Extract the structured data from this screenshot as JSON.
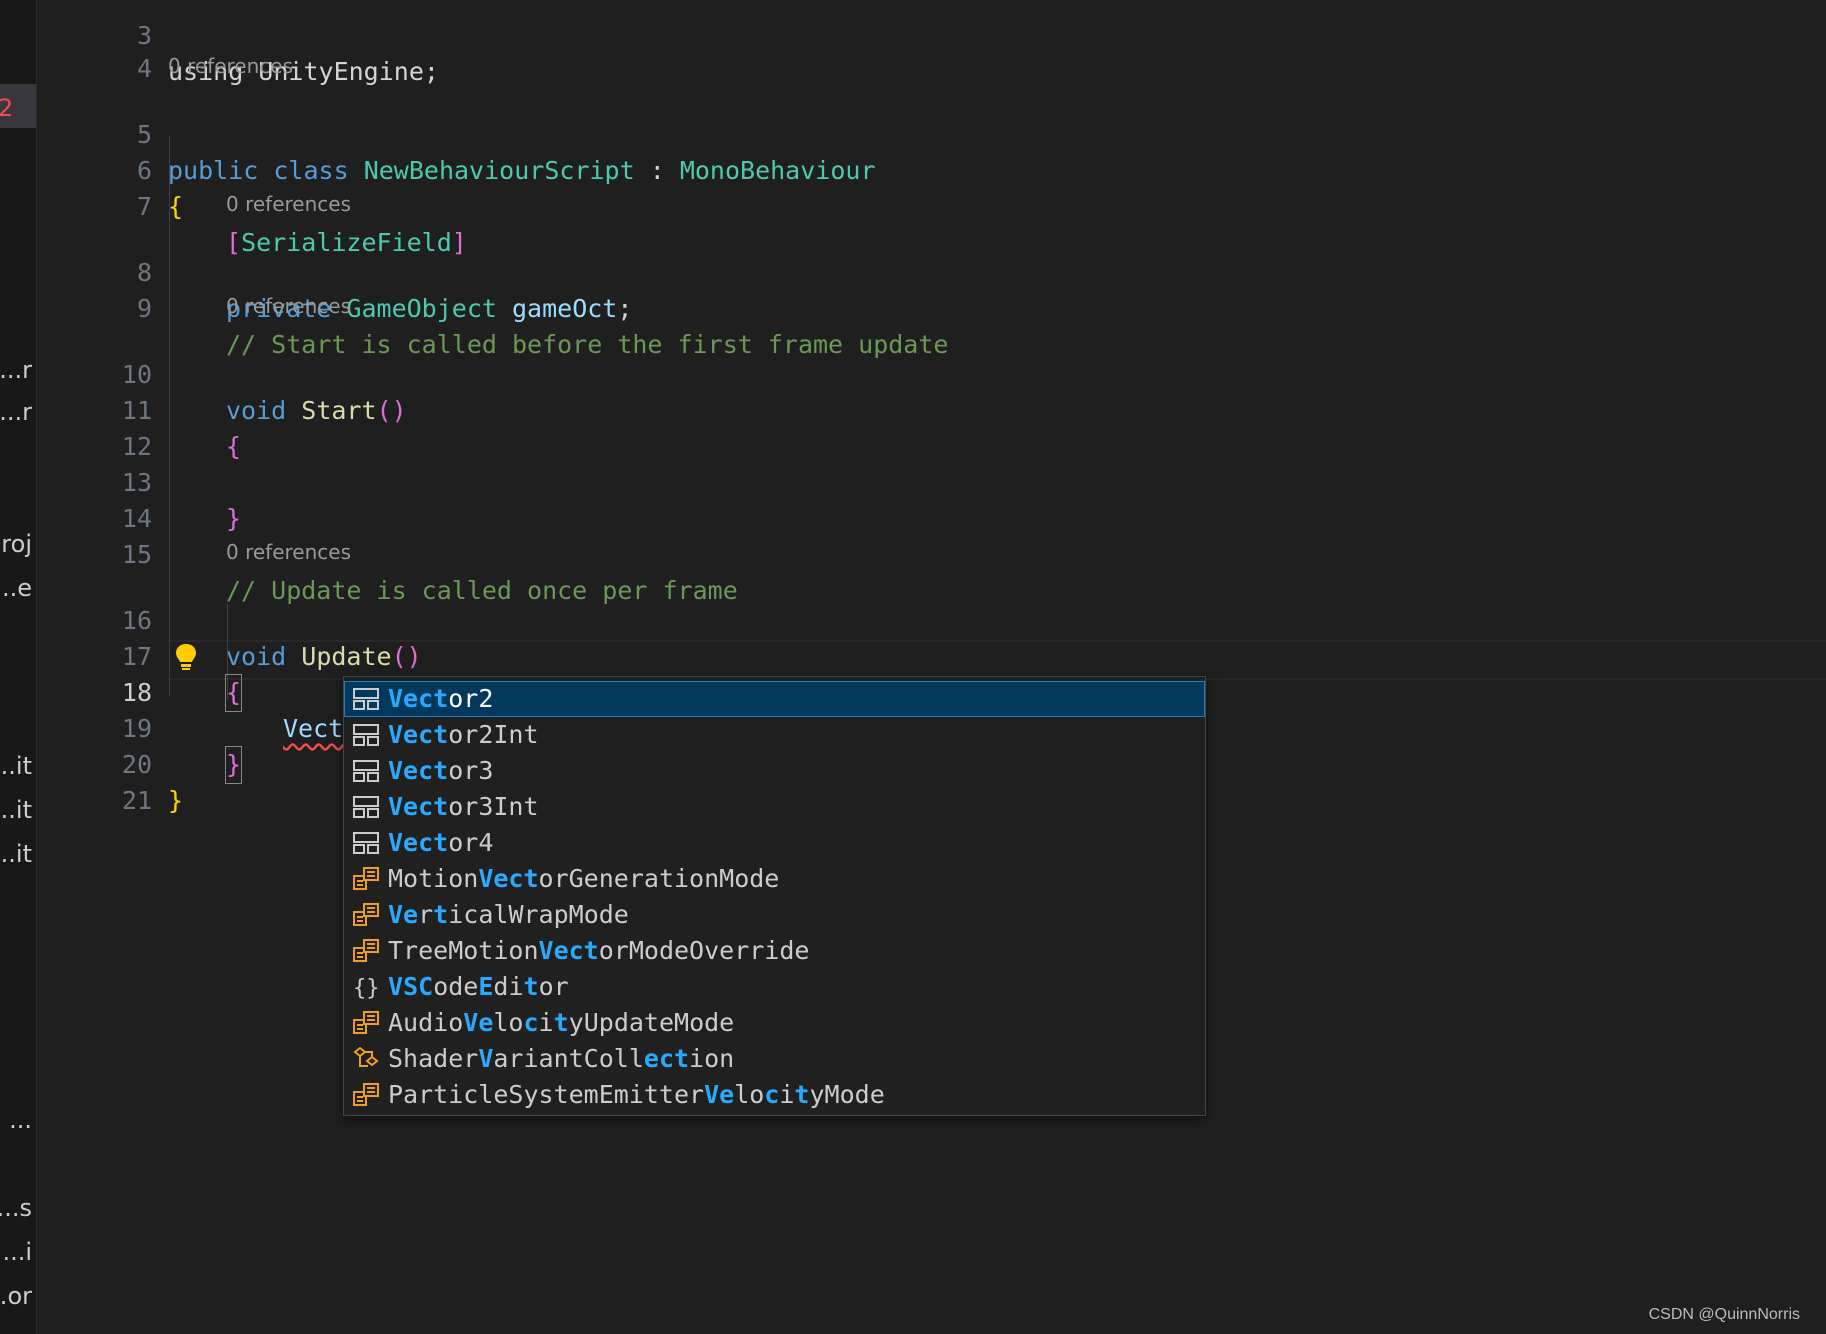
{
  "sidebar": {
    "active_marker": "2",
    "fragments": [
      "r...",
      "r...",
      "roj",
      "e...",
      "it...",
      "it...",
      "it...",
      "...",
      "s...",
      "i...",
      "or..."
    ]
  },
  "editor": {
    "lines": {
      "l3": {
        "num": "3",
        "code": "using UnityEngine;"
      },
      "l4": {
        "num": "4"
      },
      "l5": {
        "num": "5",
        "kw1": "public",
        "kw2": "class",
        "name": "NewBehaviourScript",
        "colon": ":",
        "base": "MonoBehaviour"
      },
      "l6": {
        "num": "6",
        "brace": "{"
      },
      "l7": {
        "num": "7",
        "open": "[",
        "attr": "SerializeField",
        "close": "]"
      },
      "l8": {
        "num": "8",
        "kw": "private",
        "type": "GameObject",
        "var": "gameOct",
        "semi": ";"
      },
      "l9": {
        "num": "9",
        "comment": "// Start is called before the first frame update"
      },
      "l10": {
        "num": "10",
        "kw": "void",
        "fn": "Start",
        "paren": "()"
      },
      "l11": {
        "num": "11",
        "brace": "{"
      },
      "l12": {
        "num": "12"
      },
      "l13": {
        "num": "13",
        "brace": "}"
      },
      "l14": {
        "num": "14"
      },
      "l15": {
        "num": "15",
        "comment": "// Update is called once per frame"
      },
      "l16": {
        "num": "16",
        "kw": "void",
        "fn": "Update",
        "paren": "()"
      },
      "l17": {
        "num": "17",
        "brace": "{"
      },
      "l18": {
        "num": "18",
        "typed": "Vect"
      },
      "l19": {
        "num": "19",
        "brace": "}"
      },
      "l20": {
        "num": "20",
        "brace": "}"
      },
      "l21": {
        "num": "21"
      }
    },
    "codelens": "0 references"
  },
  "suggestions": [
    {
      "kind": "struct-icon",
      "parts": [
        [
          "Vect",
          true
        ],
        [
          "or2",
          false
        ]
      ],
      "selected": true
    },
    {
      "kind": "struct-icon",
      "parts": [
        [
          "Vect",
          true
        ],
        [
          "or2Int",
          false
        ]
      ]
    },
    {
      "kind": "struct-icon",
      "parts": [
        [
          "Vect",
          true
        ],
        [
          "or3",
          false
        ]
      ]
    },
    {
      "kind": "struct-icon",
      "parts": [
        [
          "Vect",
          true
        ],
        [
          "or3Int",
          false
        ]
      ]
    },
    {
      "kind": "struct-icon",
      "parts": [
        [
          "Vect",
          true
        ],
        [
          "or4",
          false
        ]
      ]
    },
    {
      "kind": "enum-icon",
      "parts": [
        [
          "Motion",
          false
        ],
        [
          "Vect",
          true
        ],
        [
          "orGenerationMode",
          false
        ]
      ]
    },
    {
      "kind": "enum-icon",
      "parts": [
        [
          "Ve",
          true
        ],
        [
          "r",
          false
        ],
        [
          "t",
          true
        ],
        [
          "ic",
          false
        ],
        [
          "al",
          false
        ],
        [
          "WrapMode",
          false
        ]
      ]
    },
    {
      "kind": "enum-icon",
      "parts": [
        [
          "TreeMotion",
          false
        ],
        [
          "Vect",
          true
        ],
        [
          "orModeOverride",
          false
        ]
      ]
    },
    {
      "kind": "namespace-icon",
      "parts": [
        [
          "V",
          true
        ],
        [
          "S",
          true
        ],
        [
          "C",
          true
        ],
        [
          "ode",
          false
        ],
        [
          "E",
          true
        ],
        [
          "di",
          false
        ],
        [
          "t",
          true
        ],
        [
          "or",
          false
        ]
      ]
    },
    {
      "kind": "enum-icon",
      "parts": [
        [
          "Audio",
          false
        ],
        [
          "Ve",
          true
        ],
        [
          "lo",
          false
        ],
        [
          "c",
          true
        ],
        [
          "i",
          false
        ],
        [
          "t",
          true
        ],
        [
          "yUpdateMode",
          false
        ]
      ]
    },
    {
      "kind": "class-icon",
      "parts": [
        [
          "Shader",
          false
        ],
        [
          "V",
          true
        ],
        [
          "ariantColl",
          false
        ],
        [
          "ect",
          true
        ],
        [
          "ion",
          false
        ]
      ]
    },
    {
      "kind": "enum-icon",
      "parts": [
        [
          "ParticleSystemEmitter",
          false
        ],
        [
          "Ve",
          true
        ],
        [
          "lo",
          false
        ],
        [
          "c",
          true
        ],
        [
          "i",
          false
        ],
        [
          "t",
          true
        ],
        [
          "yMode",
          false
        ]
      ]
    }
  ],
  "watermark": "CSDN @QuinnNorris",
  "colors": {
    "accent": "#2aaaff",
    "selection": "#04395e",
    "bulb": "#ffcc00"
  }
}
